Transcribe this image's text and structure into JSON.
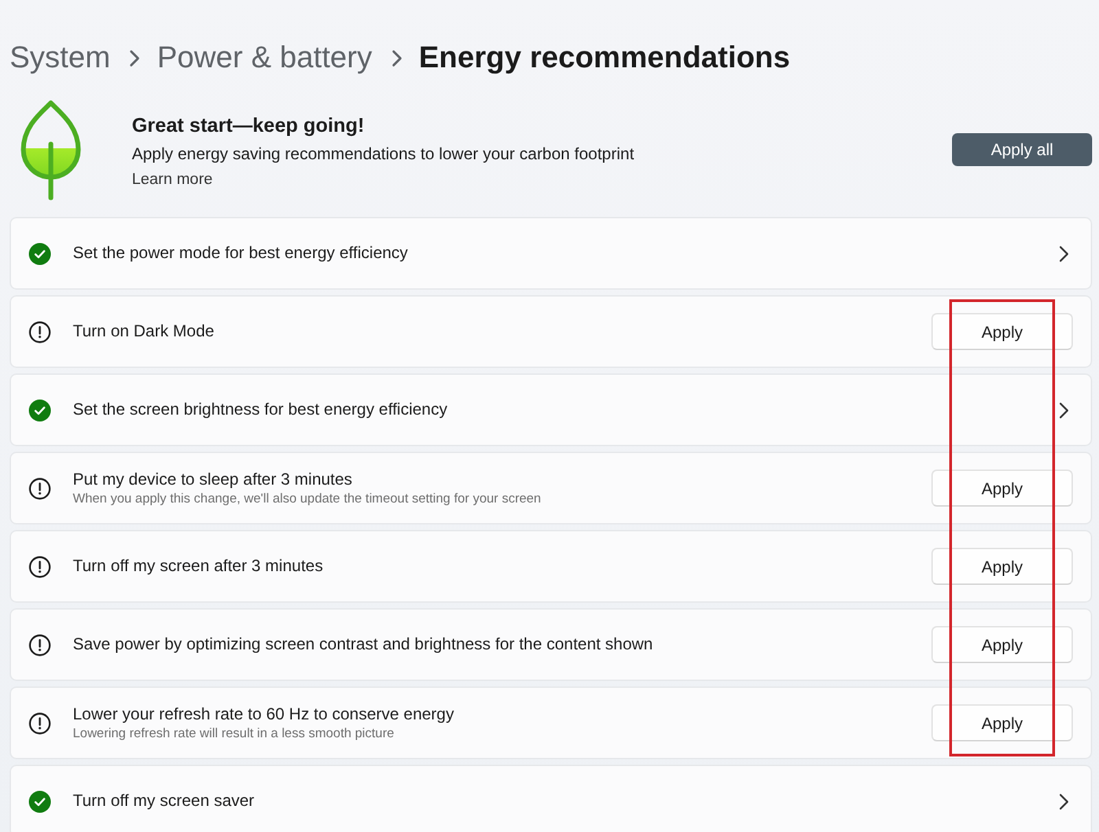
{
  "breadcrumb": [
    {
      "label": "System",
      "current": false
    },
    {
      "label": "Power & battery",
      "current": false
    },
    {
      "label": "Energy recommendations",
      "current": true
    }
  ],
  "header": {
    "title": "Great start—keep going!",
    "subtitle": "Apply energy saving recommendations to lower your carbon footprint",
    "link": "Learn more",
    "button": "Apply all"
  },
  "recommendations": [
    {
      "kind": "applied",
      "title": "Set the power mode for best energy efficiency"
    },
    {
      "kind": "pending",
      "title": "Turn on Dark Mode",
      "button": "Apply"
    },
    {
      "kind": "applied",
      "title": "Set the screen brightness for best energy efficiency"
    },
    {
      "kind": "pending",
      "title": "Put my device to sleep after 3 minutes",
      "description": "When you apply this change, we'll also update the timeout setting for your screen",
      "button": "Apply"
    },
    {
      "kind": "pending",
      "title": "Turn off my screen after 3 minutes",
      "button": "Apply"
    },
    {
      "kind": "pending",
      "title": "Save power by optimizing screen contrast and brightness for the content shown",
      "button": "Apply"
    },
    {
      "kind": "pending",
      "title": "Lower your refresh rate to 60 Hz to conserve energy",
      "description": "Lowering refresh rate will result in a less smooth picture",
      "button": "Apply"
    },
    {
      "kind": "applied",
      "title": "Turn off my screen saver"
    }
  ],
  "annotation": {
    "kind": "rectangle"
  }
}
